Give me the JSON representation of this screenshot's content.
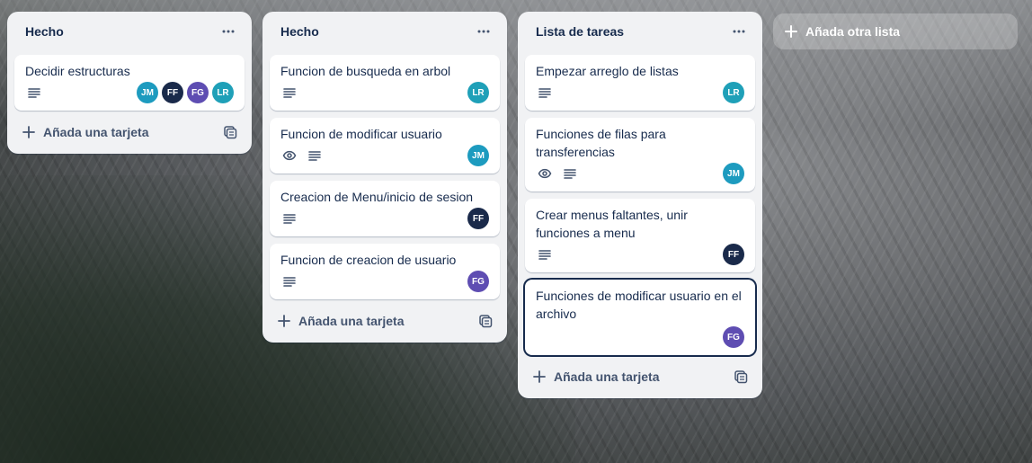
{
  "colors": {
    "JM": "#1d9bbf",
    "FF": "#1a2a4a",
    "FG": "#5e4db2",
    "LR": "#1fa0b8"
  },
  "lists": [
    {
      "title": "Hecho",
      "menu_icon": "more-horizontal-icon",
      "add_card_label": "Añada una tarjeta",
      "cards": [
        {
          "title": "Decidir estructuras",
          "watch": false,
          "description": true,
          "members": [
            "JM",
            "FF",
            "FG",
            "LR"
          ]
        }
      ]
    },
    {
      "title": "Hecho",
      "menu_icon": "more-horizontal-icon",
      "add_card_label": "Añada una tarjeta",
      "cards": [
        {
          "title": "Funcion de busqueda en arbol",
          "watch": false,
          "description": true,
          "members": [
            "LR"
          ]
        },
        {
          "title": "Funcion de modificar usuario",
          "watch": true,
          "description": true,
          "members": [
            "JM"
          ]
        },
        {
          "title": "Creacion de Menu/inicio de sesion",
          "watch": false,
          "description": true,
          "members": [
            "FF"
          ]
        },
        {
          "title": "Funcion de creacion de usuario",
          "watch": false,
          "description": true,
          "members": [
            "FG"
          ]
        }
      ]
    },
    {
      "title": "Lista de tareas",
      "menu_icon": "more-horizontal-icon",
      "add_card_label": "Añada una tarjeta",
      "cards": [
        {
          "title": "Empezar arreglo de listas",
          "watch": false,
          "description": true,
          "members": [
            "LR"
          ]
        },
        {
          "title": "Funciones de filas para transferencias",
          "watch": true,
          "description": true,
          "members": [
            "JM"
          ]
        },
        {
          "title": "Crear menus faltantes, unir funciones a menu",
          "watch": false,
          "description": true,
          "members": [
            "FF"
          ]
        },
        {
          "title": "Funciones de modificar usuario en el archivo",
          "watch": false,
          "description": false,
          "members": [
            "FG"
          ],
          "focused": true
        }
      ]
    }
  ],
  "add_list": {
    "label": "Añada otra lista",
    "icon": "plus-icon"
  }
}
